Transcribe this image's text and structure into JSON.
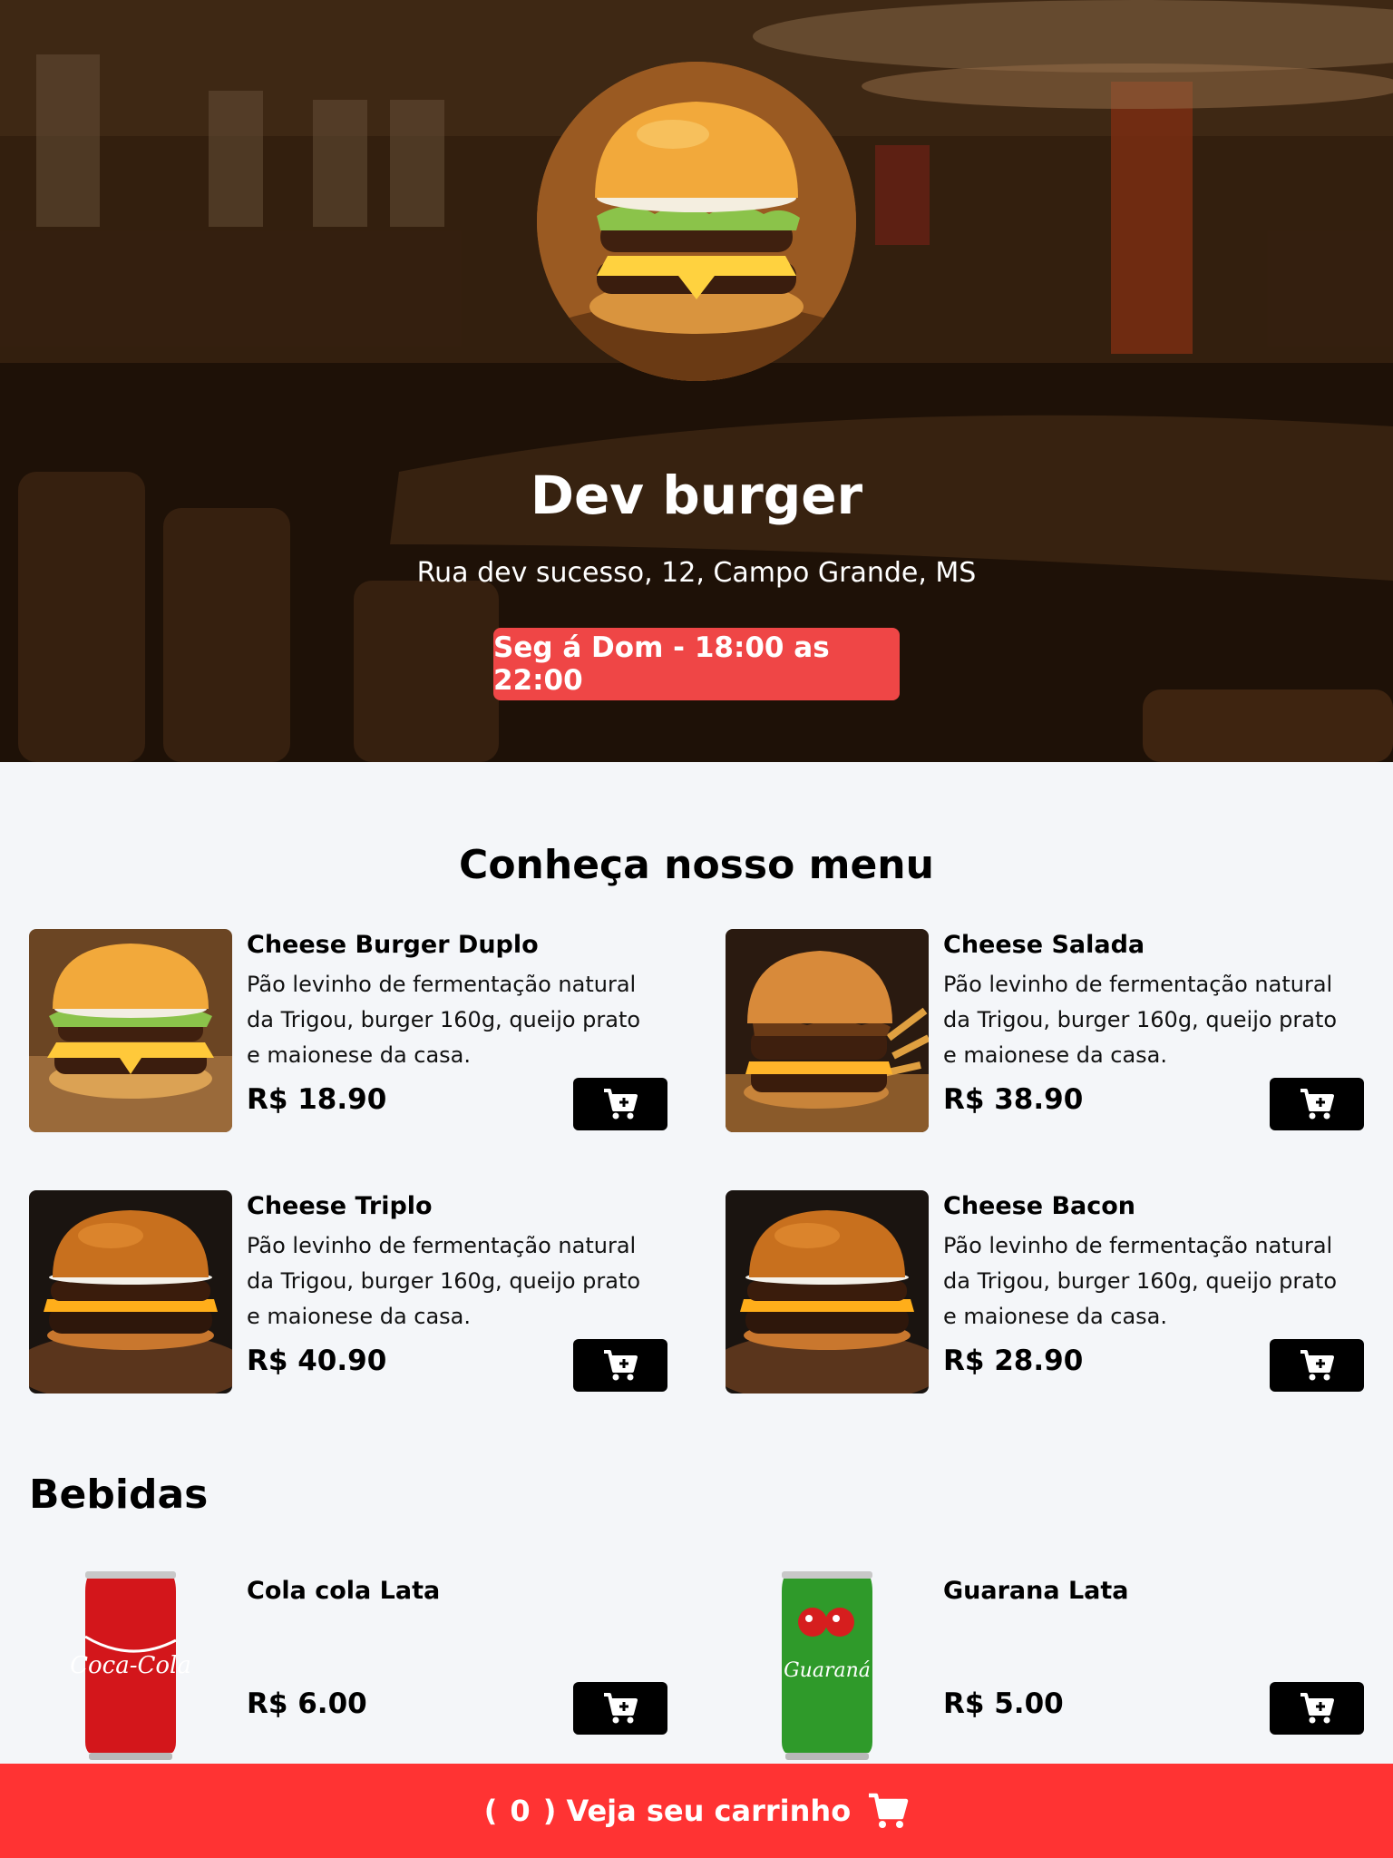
{
  "header": {
    "title": "Dev burger",
    "address": "Rua dev sucesso, 12, Campo Grande, MS",
    "hours": "Seg á Dom - 18:00 as 22:00"
  },
  "menu": {
    "title": "Conheça nosso menu",
    "items": [
      {
        "name": "Cheese Burger Duplo",
        "description": "Pão levinho de fermentação natural da Trigou, burger 160g, queijo prato e maionese da casa.",
        "price": "R$ 18.90"
      },
      {
        "name": "Cheese Salada",
        "description": "Pão levinho de fermentação natural da Trigou, burger 160g, queijo prato e maionese da casa.",
        "price": "R$ 38.90"
      },
      {
        "name": "Cheese Triplo",
        "description": "Pão levinho de fermentação natural da Trigou, burger 160g, queijo prato e maionese da casa.",
        "price": "R$ 40.90"
      },
      {
        "name": "Cheese Bacon",
        "description": "Pão levinho de fermentação natural da Trigou, burger 160g, queijo prato e maionese da casa.",
        "price": "R$ 28.90"
      }
    ]
  },
  "drinks": {
    "title": "Bebidas",
    "items": [
      {
        "name": "Cola cola Lata",
        "price": "R$ 6.00",
        "can_text": "Coca-Cola"
      },
      {
        "name": "Guarana Lata",
        "price": "R$ 5.00",
        "can_text": "Guaraná"
      }
    ]
  },
  "footer": {
    "open_paren": "(",
    "count": "0",
    "close_label": ") Veja seu carrinho"
  },
  "colors": {
    "accent_red": "#ef4646",
    "footer_red": "#ff3333",
    "button_black": "#000000"
  }
}
